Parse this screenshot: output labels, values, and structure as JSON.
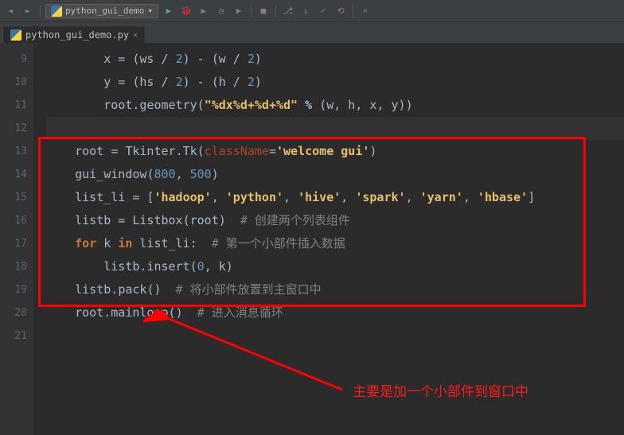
{
  "toolbar": {
    "dropdown_label": "python_gui_demo"
  },
  "tab": {
    "filename": "python_gui_demo.py"
  },
  "gutter": [
    "9",
    "10",
    "11",
    "12",
    "13",
    "14",
    "15",
    "16",
    "17",
    "18",
    "19",
    "20",
    "21"
  ],
  "code": {
    "l9": {
      "indent": "        ",
      "v": "x",
      "eq": " = ",
      "p1": "(",
      "ws": "ws",
      "div1": " / ",
      "two1": "2",
      "p2": ")",
      "minus": " - ",
      "p3": "(",
      "w": "w",
      "div2": " / ",
      "two2": "2",
      "p4": ")"
    },
    "l10": {
      "indent": "        ",
      "v": "y",
      "eq": " = ",
      "p1": "(",
      "hs": "hs",
      "div1": " / ",
      "two1": "2",
      "p2": ")",
      "minus": " - ",
      "p3": "(",
      "h": "h",
      "div2": " / ",
      "two2": "2",
      "p4": ")"
    },
    "l11": {
      "indent": "        ",
      "root": "root",
      "dot": ".",
      "geom": "geometry",
      "p1": "(",
      "fmt": "\"%dx%d+%d+%d\"",
      "pct": " % ",
      "p2": "(",
      "args": "w, h, x, y",
      "p3": ")",
      "p4": ")"
    },
    "l12": "",
    "l13": {
      "indent": "    ",
      "root": "root",
      "eq": " = ",
      "tk": "Tkinter",
      "dot": ".",
      "tkcall": "Tk",
      "p1": "(",
      "kwarg": "className",
      "eq2": "=",
      "str": "'welcome gui'",
      "p2": ")"
    },
    "l14": {
      "indent": "    ",
      "fn": "gui_window",
      "p1": "(",
      "a1": "800",
      "c": ", ",
      "a2": "500",
      "p2": ")"
    },
    "l15": {
      "indent": "    ",
      "v": "list_li",
      "eq": " = ",
      "br1": "[",
      "s1": "'hadoop'",
      "c1": ", ",
      "s2": "'python'",
      "c2": ", ",
      "s3": "'hive'",
      "c3": ", ",
      "s4": "'spark'",
      "c4": ", ",
      "s5": "'yarn'",
      "c5": ", ",
      "s6": "'hbase'",
      "br2": "]"
    },
    "l16": {
      "indent": "    ",
      "v": "listb",
      "eq": " = ",
      "cls": "Listbox",
      "p1": "(",
      "arg": "root",
      "p2": ")",
      "sp": "  ",
      "cm": "# 创建两个列表组件"
    },
    "l17": {
      "indent": "    ",
      "for": "for",
      "sp1": " ",
      "k": "k",
      "sp2": " ",
      "in": "in",
      "sp3": " ",
      "li": "list_li",
      "col": ":",
      "sp4": "  ",
      "cm": "# 第一个小部件插入数据"
    },
    "l18": {
      "indent": "        ",
      "v": "listb",
      "dot": ".",
      "m": "insert",
      "p1": "(",
      "a1": "0",
      "c": ", ",
      "a2": "k",
      "p2": ")"
    },
    "l19": {
      "indent": "    ",
      "v": "listb",
      "dot": ".",
      "m": "pack",
      "p1": "(",
      "p2": ")",
      "sp": "  ",
      "cm": "# 将小部件放置到主窗口中"
    },
    "l20": {
      "indent": "    ",
      "v": "root",
      "dot": ".",
      "m": "mainloop",
      "p1": "(",
      "p2": ")",
      "sp": "  ",
      "cm": "# 进入消息循环"
    },
    "l21": ""
  },
  "annotation": "主要是加一个小部件到窗口中"
}
